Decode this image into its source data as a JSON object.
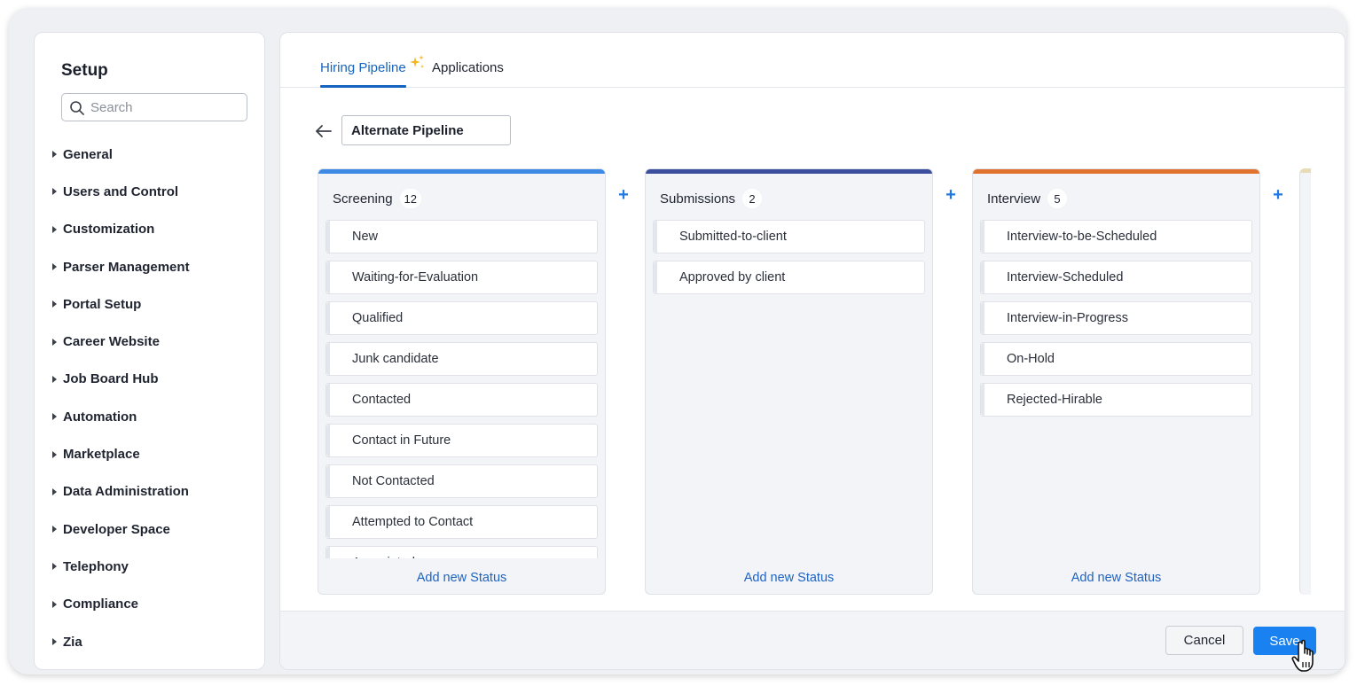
{
  "sidebar": {
    "title": "Setup",
    "search_placeholder": "Search",
    "items": [
      {
        "label": "General"
      },
      {
        "label": "Users and Control"
      },
      {
        "label": "Customization"
      },
      {
        "label": "Parser Management"
      },
      {
        "label": "Portal Setup"
      },
      {
        "label": "Career Website"
      },
      {
        "label": "Job Board Hub"
      },
      {
        "label": "Automation"
      },
      {
        "label": "Marketplace"
      },
      {
        "label": "Data Administration"
      },
      {
        "label": "Developer Space"
      },
      {
        "label": "Telephony"
      },
      {
        "label": "Compliance"
      },
      {
        "label": "Zia"
      }
    ]
  },
  "tabs": {
    "hiring_pipeline": "Hiring Pipeline",
    "applications": "Applications"
  },
  "pipeline": {
    "name": "Alternate Pipeline"
  },
  "columns": [
    {
      "title": "Screening",
      "count": "12",
      "color": "#3d8ae6",
      "statuses": [
        "New",
        "Waiting-for-Evaluation",
        "Qualified",
        "Junk candidate",
        "Contacted",
        "Contact in Future",
        "Not Contacted",
        "Attempted to Contact",
        "Associated"
      ],
      "add_label": "Add new Status"
    },
    {
      "title": "Submissions",
      "count": "2",
      "color": "#3b4f9e",
      "statuses": [
        "Submitted-to-client",
        "Approved by client"
      ],
      "add_label": "Add new Status"
    },
    {
      "title": "Interview",
      "count": "5",
      "color": "#e0722e",
      "statuses": [
        "Interview-to-be-Scheduled",
        "Interview-Scheduled",
        "Interview-in-Progress",
        "On-Hold",
        "Rejected-Hirable"
      ],
      "add_label": "Add new Status"
    }
  ],
  "footer": {
    "cancel_label": "Cancel",
    "save_label": "Save"
  },
  "icons": {
    "plus": "+",
    "accent": "#1a82f0",
    "tab_active": "#1565c0",
    "sparkle_color": "#f2b51c"
  }
}
